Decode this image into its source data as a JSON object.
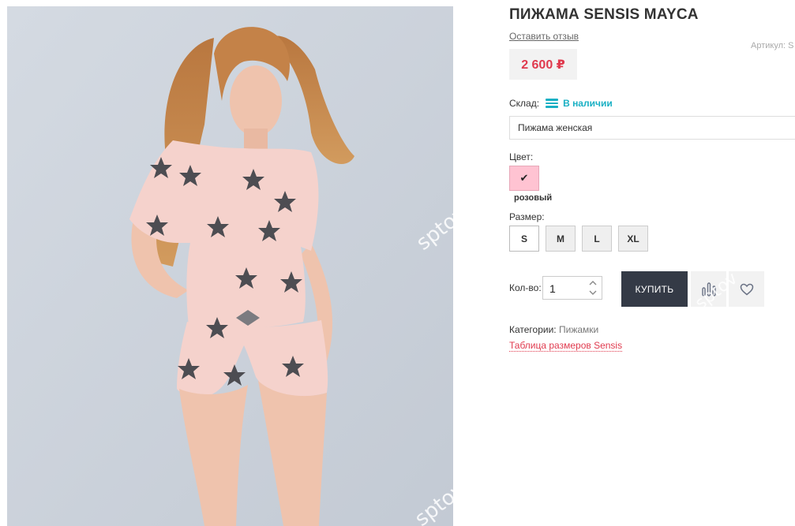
{
  "product": {
    "title": "ПИЖАМА SENSIS MAYCA",
    "review_link": "Оставить отзыв",
    "sku_label": "Артикул: S",
    "price": "2 600 ₽"
  },
  "stock": {
    "label": "Склад:",
    "status": "В наличии",
    "icon": "stock-lines-icon"
  },
  "variant_select": {
    "value": "Пижама женская"
  },
  "color": {
    "label": "Цвет:",
    "selected_name": "розовый",
    "swatch_color": "#ffc3d2",
    "check_icon": "✔"
  },
  "size": {
    "label": "Размер:",
    "options": [
      "S",
      "M",
      "L",
      "XL"
    ],
    "selected": "S"
  },
  "quantity": {
    "label": "Кол-во:",
    "value": "1"
  },
  "actions": {
    "buy_label": "КУПИТЬ",
    "compare_icon": "compare-icon",
    "favorite_icon": "heart-icon"
  },
  "categories": {
    "label": "Категории:",
    "value": "Пижамки"
  },
  "size_table_link": "Таблица размеров Sensis",
  "watermark": "sptov",
  "colors": {
    "accent": "#e03a4e",
    "stock": "#1ab0c4",
    "buy_bg": "#343a46"
  }
}
